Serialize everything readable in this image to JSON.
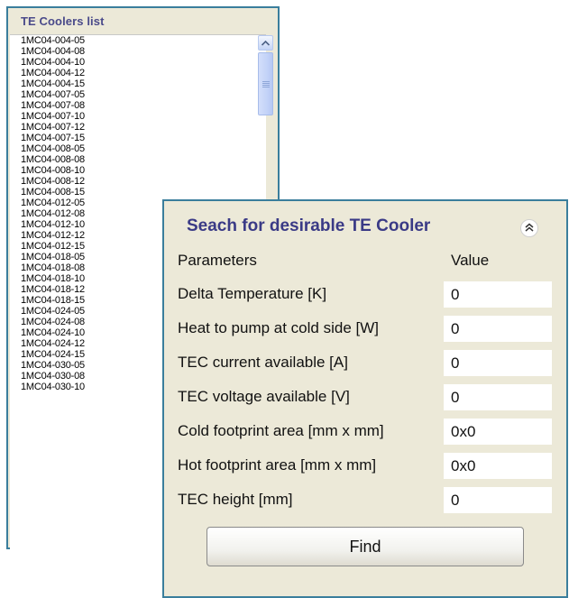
{
  "list_panel": {
    "title": "TE Coolers list",
    "items": [
      "1MC04-004-05",
      "1MC04-004-08",
      "1MC04-004-10",
      "1MC04-004-12",
      "1MC04-004-15",
      "1MC04-007-05",
      "1MC04-007-08",
      "1MC04-007-10",
      "1MC04-007-12",
      "1MC04-007-15",
      "1MC04-008-05",
      "1MC04-008-08",
      "1MC04-008-10",
      "1MC04-008-12",
      "1MC04-008-15",
      "1MC04-012-05",
      "1MC04-012-08",
      "1MC04-012-10",
      "1MC04-012-12",
      "1MC04-012-15",
      "1MC04-018-05",
      "1MC04-018-08",
      "1MC04-018-10",
      "1MC04-018-12",
      "1MC04-018-15",
      "1MC04-024-05",
      "1MC04-024-08",
      "1MC04-024-10",
      "1MC04-024-12",
      "1MC04-024-15",
      "1MC04-030-05",
      "1MC04-030-08",
      "1MC04-030-10"
    ]
  },
  "search_panel": {
    "title": "Seach for desirable TE Cooler",
    "collapse_icon": "double-chevron-up-icon",
    "column_parameters": "Parameters",
    "column_value": "Value",
    "params": [
      {
        "label": "Delta Temperature [K]",
        "value": "0"
      },
      {
        "label": "Heat to pump at cold side [W]",
        "value": "0"
      },
      {
        "label": "TEC current available [A]",
        "value": "0"
      },
      {
        "label": "TEC voltage available [V]",
        "value": "0"
      },
      {
        "label": "Cold footprint area [mm x mm]",
        "value": "0x0"
      },
      {
        "label": "Hot footprint area [mm x mm]",
        "value": "0x0"
      },
      {
        "label": "TEC height [mm]",
        "value": "0"
      }
    ],
    "find_label": "Find"
  },
  "colors": {
    "panel_border": "#3a7e9c",
    "panel_bg": "#ece9d8",
    "title_color": "#3a3a86"
  }
}
